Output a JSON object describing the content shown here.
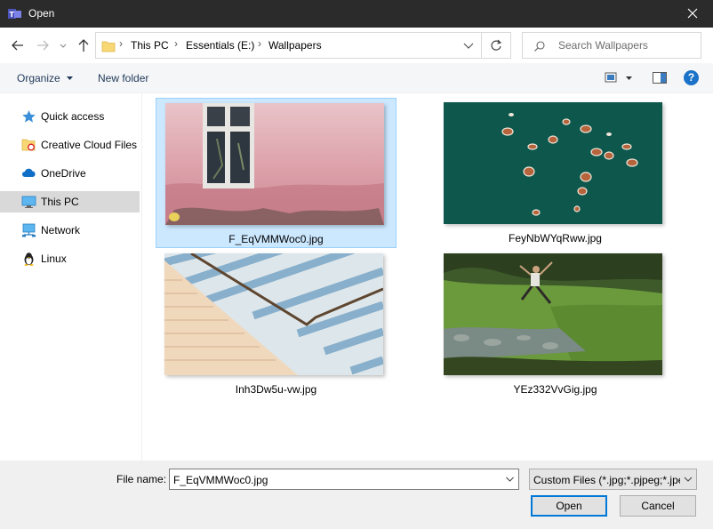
{
  "window": {
    "title": "Open"
  },
  "address": {
    "crumbs": [
      "This PC",
      "Essentials (E:)",
      "Wallpapers"
    ]
  },
  "search": {
    "placeholder": "Search Wallpapers"
  },
  "toolbar": {
    "organize_label": "Organize",
    "new_folder_label": "New folder",
    "help_label": "?"
  },
  "sidebar": {
    "items": [
      {
        "label": "Quick access",
        "icon": "star-icon"
      },
      {
        "label": "Creative Cloud Files",
        "icon": "creative-cloud-folder-icon"
      },
      {
        "label": "OneDrive",
        "icon": "cloud-icon"
      },
      {
        "label": "This PC",
        "icon": "computer-icon",
        "selected": true
      },
      {
        "label": "Network",
        "icon": "network-icon"
      },
      {
        "label": "Linux",
        "icon": "penguin-icon"
      }
    ]
  },
  "files": [
    {
      "name": "F_EqVMMWoc0.jpg",
      "selected": true
    },
    {
      "name": "FeyNbWYqRww.jpg"
    },
    {
      "name": "Inh3Dw5u-vw.jpg"
    },
    {
      "name": "YEz332VvGig.jpg"
    }
  ],
  "footer": {
    "file_name_label": "File name:",
    "file_name_value": "F_EqVMMWoc0.jpg",
    "filter_value": "Custom Files (*.jpg;*.pjpeg;*.jpeg;*.png)",
    "open_label": "Open",
    "cancel_label": "Cancel"
  },
  "colors": {
    "accent": "#0078d7",
    "selection": "#cce8ff",
    "titlebar": "#2b2b2b"
  }
}
